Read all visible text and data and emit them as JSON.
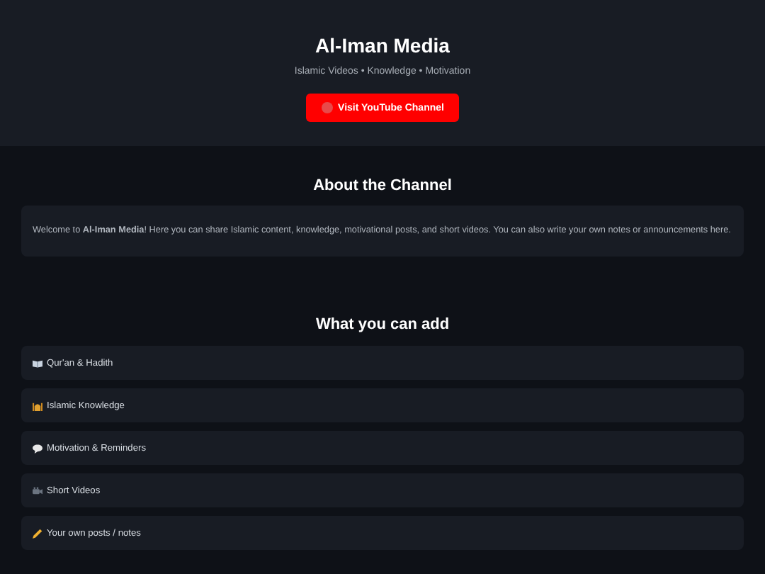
{
  "header": {
    "title": "Al-Iman Media",
    "subtitle": "Islamic Videos • Knowledge • Motivation",
    "button": "Visit YouTube Channel"
  },
  "about": {
    "heading": "About the Channel",
    "text": "Welcome to **Al-Iman Media**! Here you can share Islamic content, knowledge, motivational posts, and short videos. You can also write your own notes or announcements here."
  },
  "features": {
    "heading": "What you can add",
    "items": [
      {
        "kind": "book",
        "label": "Qur'an & Hadith"
      },
      {
        "kind": "mosque",
        "label": "Islamic Knowledge"
      },
      {
        "kind": "speech",
        "label": "Motivation & Reminders"
      },
      {
        "kind": "camera",
        "label": "Short Videos"
      },
      {
        "kind": "pencil",
        "label": "Your own posts / notes"
      }
    ]
  }
}
